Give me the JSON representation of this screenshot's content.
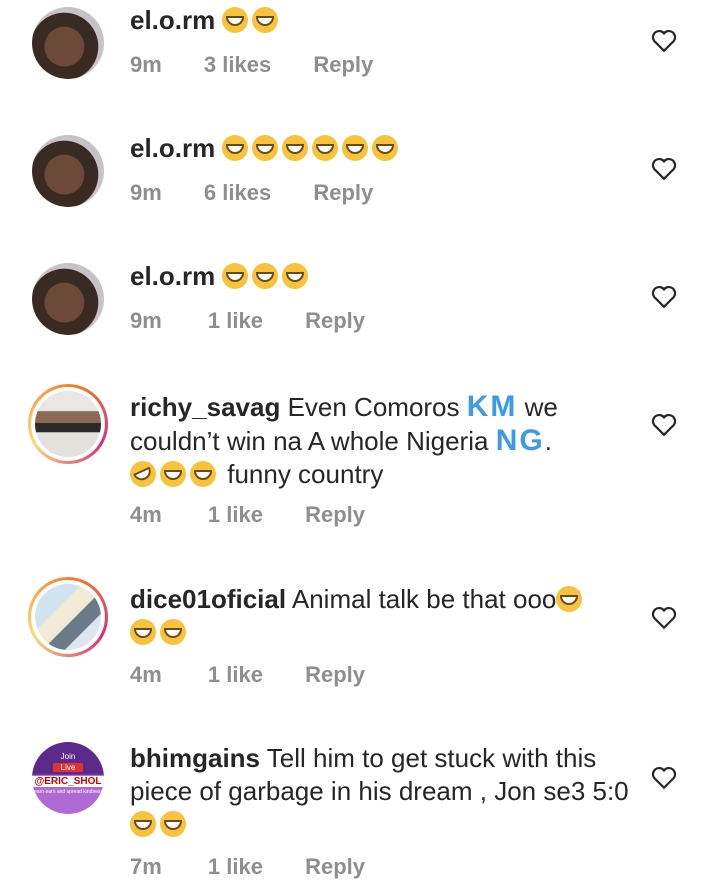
{
  "comments": [
    {
      "username": "el.o.rm",
      "text": "",
      "emoji_count": 2,
      "time": "9m",
      "likes": "3 likes",
      "reply": "Reply"
    },
    {
      "username": "el.o.rm",
      "text": "",
      "emoji_count": 6,
      "time": "9m",
      "likes": "6 likes",
      "reply": "Reply"
    },
    {
      "username": "el.o.rm",
      "text": "",
      "emoji_count": 3,
      "time": "9m",
      "likes": "1 like",
      "reply": "Reply"
    },
    {
      "username": "richy_savag",
      "text_a": "Even Comoros",
      "flag1": "KM",
      "text_b": "we couldn’t win na A whole Nigeria",
      "flag2": "NG",
      "text_c": ".",
      "text_d": "funny country",
      "time": "4m",
      "likes": "1 like",
      "reply": "Reply"
    },
    {
      "username": "dice01oficial",
      "text": "Animal talk be that ooo",
      "time": "4m",
      "likes": "1 like",
      "reply": "Reply"
    },
    {
      "username": "bhimgains",
      "text": "Tell him to get stuck with this piece of garbage in his dream , Jon se3 5:0",
      "time": "7m",
      "likes": "1 like",
      "reply": "Reply"
    }
  ],
  "avatar_badge": {
    "line1": "Join",
    "line2": "Live",
    "handle": "@ERIC_SHOL",
    "sub": "learn earn and spread kindness"
  },
  "colors": {
    "accent": "#262626",
    "muted": "#8e8e8e",
    "emoji": "#f6c33b",
    "flag": "#3b9be6"
  }
}
